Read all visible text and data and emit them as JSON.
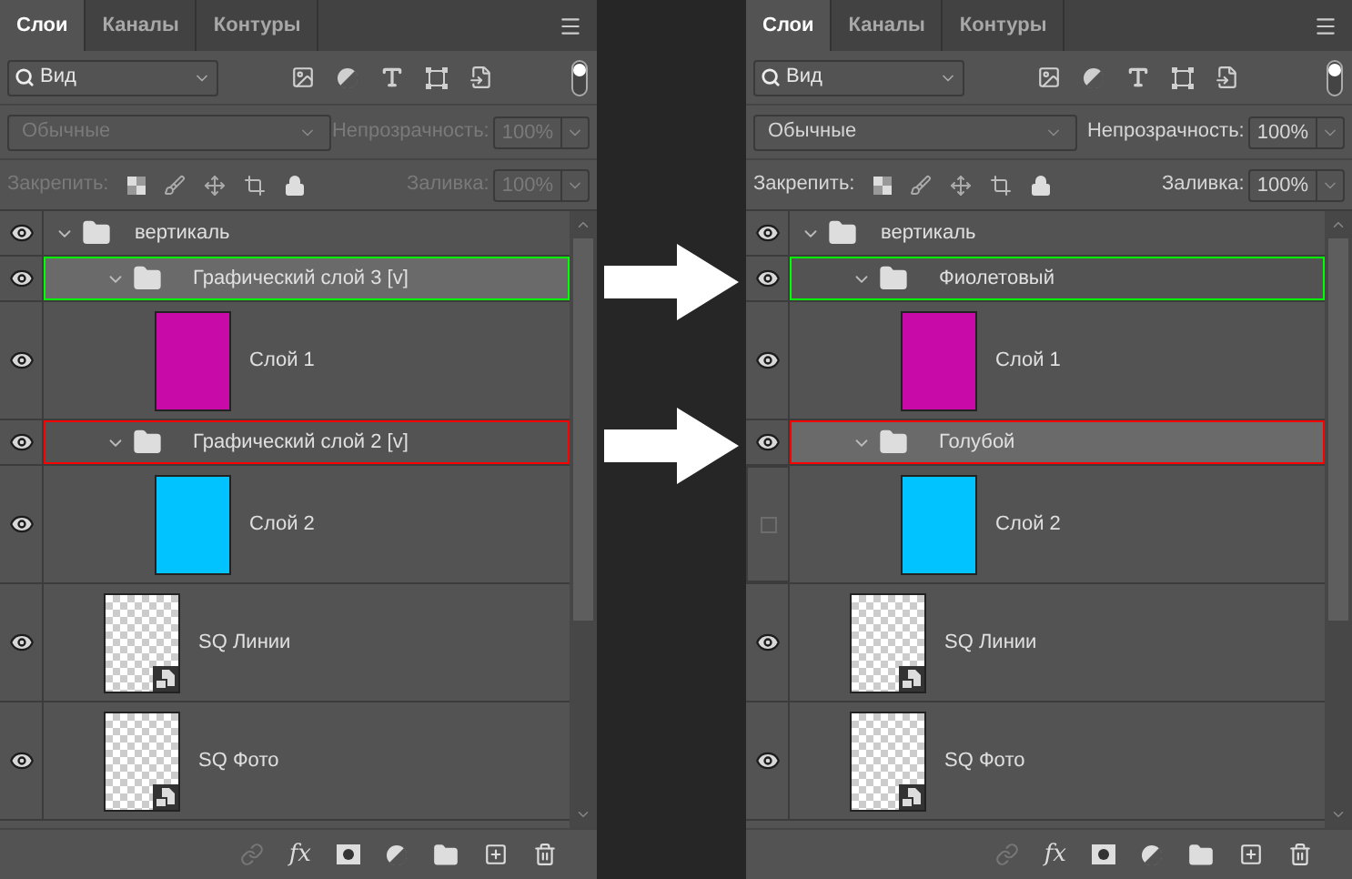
{
  "panels": [
    {
      "tabs": [
        {
          "label": "Слои",
          "selected": true
        },
        {
          "label": "Каналы",
          "selected": false
        },
        {
          "label": "Контуры",
          "selected": false
        }
      ],
      "filter": {
        "value": "Вид"
      },
      "blend_mode": {
        "value": "Обычные",
        "disabled": true
      },
      "opacity": {
        "label": "Непрозрачность:",
        "value": "100%",
        "disabled": true
      },
      "lock": {
        "label": "Закрепить:",
        "disabled": true
      },
      "fill": {
        "label": "Заливка:",
        "value": "100%",
        "disabled": true
      },
      "layers": [
        {
          "name": "вертикаль",
          "kind": "group",
          "visible": true,
          "selected": false,
          "children": [
            {
              "name": "Графический слой 3 [v]",
              "kind": "group",
              "visible": true,
              "selected": true,
              "color": "#00ff00",
              "children": [
                {
                  "name": "Слой 1",
                  "kind": "layer",
                  "visible": true,
                  "selected": false,
                  "thumbnail": {
                    "kind": "fill",
                    "color": "#c80aa8"
                  }
                }
              ]
            },
            {
              "name": "Графический слой 2 [v]",
              "kind": "group",
              "visible": true,
              "selected": false,
              "color": "#ff0000",
              "children": [
                {
                  "name": "Слой 2",
                  "kind": "layer",
                  "visible": true,
                  "selected": false,
                  "thumbnail": {
                    "kind": "fill",
                    "color": "#00c3ff"
                  }
                }
              ]
            }
          ]
        },
        {
          "name": "SQ Линии",
          "kind": "layer",
          "visible": true,
          "selected": false,
          "thumbnail": {
            "kind": "smart"
          }
        },
        {
          "name": "SQ Фото",
          "kind": "layer",
          "visible": true,
          "selected": false,
          "thumbnail": {
            "kind": "smart"
          }
        }
      ],
      "fx_label": "fx"
    },
    {
      "tabs": [
        {
          "label": "Слои",
          "selected": true
        },
        {
          "label": "Каналы",
          "selected": false
        },
        {
          "label": "Контуры",
          "selected": false
        }
      ],
      "filter": {
        "value": "Вид"
      },
      "blend_mode": {
        "value": "Обычные",
        "disabled": false
      },
      "opacity": {
        "label": "Непрозрачность:",
        "value": "100%",
        "disabled": false
      },
      "lock": {
        "label": "Закрепить:",
        "disabled": false
      },
      "fill": {
        "label": "Заливка:",
        "value": "100%",
        "disabled": false
      },
      "layers": [
        {
          "name": "вертикаль",
          "kind": "group",
          "visible": true,
          "selected": false,
          "children": [
            {
              "name": "Фиолетовый",
              "kind": "group",
              "visible": true,
              "selected": false,
              "color": "#00ff00",
              "children": [
                {
                  "name": "Слой 1",
                  "kind": "layer",
                  "visible": true,
                  "selected": false,
                  "thumbnail": {
                    "kind": "fill",
                    "color": "#c80aa8"
                  }
                }
              ]
            },
            {
              "name": "Голубой",
              "kind": "group",
              "visible": true,
              "selected": true,
              "color": "#ff0000",
              "children": [
                {
                  "name": "Слой 2",
                  "kind": "layer",
                  "visible": false,
                  "selected": false,
                  "thumbnail": {
                    "kind": "fill",
                    "color": "#00c3ff"
                  }
                }
              ]
            }
          ]
        },
        {
          "name": "SQ Линии",
          "kind": "layer",
          "visible": true,
          "selected": false,
          "thumbnail": {
            "kind": "smart"
          }
        },
        {
          "name": "SQ Фото",
          "kind": "layer",
          "visible": true,
          "selected": false,
          "thumbnail": {
            "kind": "smart"
          }
        }
      ],
      "fx_label": "fx"
    }
  ]
}
